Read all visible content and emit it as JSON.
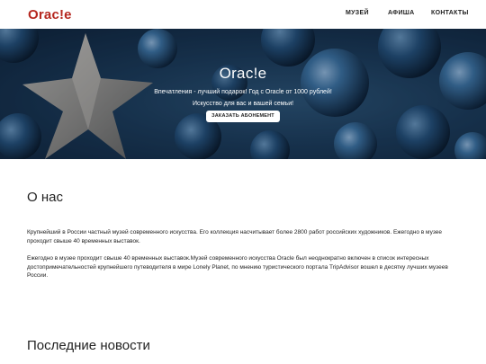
{
  "header": {
    "logo": "Orac!e",
    "nav": [
      "МУЗЕЙ",
      "АФИША",
      "КОНТАКТЫ"
    ]
  },
  "hero": {
    "title": "Orac!e",
    "line1": "Впечатления - лучший подарок! Год с Oracle от 1000 рублей!",
    "line2": "Искусство для вас и вашей семьи!",
    "button": "ЗАКАЗАТЬ АБОНЕМЕНТ"
  },
  "about": {
    "title": "О нас",
    "paragraph1": "Крупнейший в России частный музей современного искусства. Его коллекция насчитывает более 2800 работ российских художников. Ежегодно в музее проходит свыше 40 временных выставок.",
    "paragraph2": "Ежегодно в музее проходит свыше 40 временных выставок.Музей современного искусства Oracle был неоднократно включен в список интересных достопримечательностей крупнейшего путеводителя в мире Lonely Planet, по мнению туристического портала TripAdvisor вошел в десятку лучших музеев России."
  },
  "news": {
    "title": "Последние новости"
  },
  "colors": {
    "brand": "#b5271f",
    "hero_dark": "#0d2036",
    "hero_mid": "#2d5577"
  }
}
